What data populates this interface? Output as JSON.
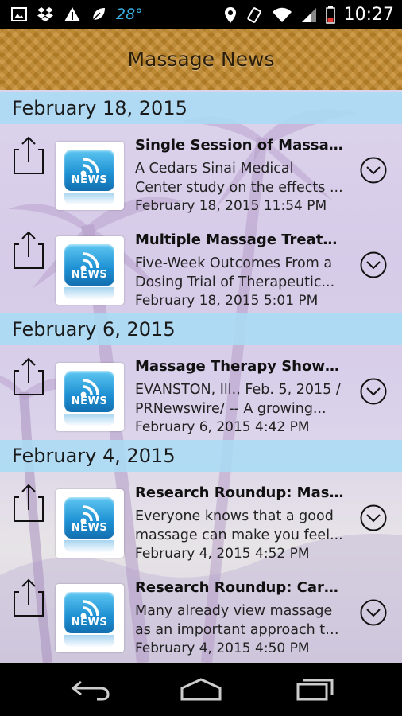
{
  "status_bar": {
    "temperature": "28°",
    "time": "10:27",
    "icons": [
      "image-icon",
      "dropbox-icon",
      "warning-icon",
      "leaf-icon",
      "location-icon",
      "rotate-icon",
      "wifi-icon",
      "signal-icon",
      "battery-icon"
    ]
  },
  "header": {
    "title": "Massage News"
  },
  "sections": [
    {
      "date": "February 18, 2015"
    },
    {
      "date": "February 6, 2015"
    },
    {
      "date": "February 4, 2015"
    }
  ],
  "items": [
    {
      "title": "Single Session of Massag...",
      "desc1": "A Cedars Sinai Medical",
      "desc2": "Center study on the effects ...",
      "timestamp": "February 18, 2015 11:54 PM",
      "thumb_label": "NEWS"
    },
    {
      "title": "Multiple Massage Treatme...",
      "desc1": "Five-Week Outcomes From a",
      "desc2": "Dosing Trial of Therapeutic...",
      "timestamp": "February 18, 2015 5:01 PM",
      "thumb_label": "NEWS"
    },
    {
      "title": "Massage Therapy Shown t...",
      "desc1": "EVANSTON, Ill., Feb. 5, 2015 /",
      "desc2": "PRNewswire/ -- A growing...",
      "timestamp": "February 6, 2015 4:42 PM",
      "thumb_label": "NEWS"
    },
    {
      "title": "Research Roundup: Mass...",
      "desc1": "Everyone knows that a good",
      "desc2": "massage can make you feel...",
      "timestamp": "February 4, 2015 4:52 PM",
      "thumb_label": "NEWS"
    },
    {
      "title": "Research Roundup: Cardi...",
      "desc1": "Many already view massage",
      "desc2": "as an important approach to...",
      "timestamp": "February 4, 2015 4:50 PM",
      "thumb_label": "NEWS"
    }
  ],
  "colors": {
    "header": "#c4892a",
    "date_band": "#a8dcf5",
    "news_icon": "#1c8fd2"
  }
}
